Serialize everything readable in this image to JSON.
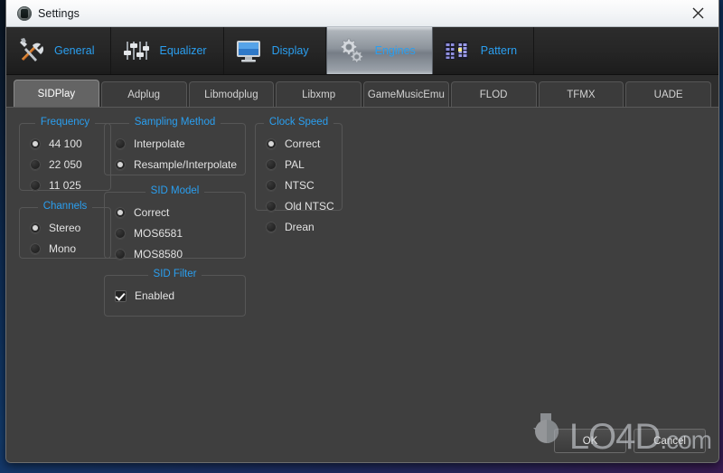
{
  "window": {
    "title": "Settings",
    "app_icon": "app-logo-icon",
    "close_icon": "close-icon",
    "accent_color": "#2a9ff0",
    "panel_color": "#3f3f3f"
  },
  "toolbar": {
    "tabs": [
      {
        "label": "General",
        "icon": "tools-icon",
        "active": false
      },
      {
        "label": "Equalizer",
        "icon": "sliders-icon",
        "active": false
      },
      {
        "label": "Display",
        "icon": "monitor-icon",
        "active": false
      },
      {
        "label": "Engines",
        "icon": "gears-icon",
        "active": true
      },
      {
        "label": "Pattern",
        "icon": "tracker-icon",
        "active": false
      }
    ]
  },
  "subtabs": {
    "items": [
      {
        "label": "SIDPlay",
        "active": true
      },
      {
        "label": "Adplug",
        "active": false
      },
      {
        "label": "Libmodplug",
        "active": false
      },
      {
        "label": "Libxmp",
        "active": false
      },
      {
        "label": "GameMusicEmu",
        "active": false
      },
      {
        "label": "FLOD",
        "active": false
      },
      {
        "label": "TFMX",
        "active": false
      },
      {
        "label": "UADE",
        "active": false
      }
    ]
  },
  "groups": {
    "frequency": {
      "title": "Frequency",
      "options": [
        {
          "label": "44 100",
          "selected": true
        },
        {
          "label": "22 050",
          "selected": false
        },
        {
          "label": "11 025",
          "selected": false
        }
      ]
    },
    "channels": {
      "title": "Channels",
      "options": [
        {
          "label": "Stereo",
          "selected": true
        },
        {
          "label": "Mono",
          "selected": false
        }
      ]
    },
    "sampling_method": {
      "title": "Sampling Method",
      "options": [
        {
          "label": "Interpolate",
          "selected": false
        },
        {
          "label": "Resample/Interpolate",
          "selected": true
        }
      ]
    },
    "sid_model": {
      "title": "SID Model",
      "options": [
        {
          "label": "Correct",
          "selected": true
        },
        {
          "label": "MOS6581",
          "selected": false
        },
        {
          "label": "MOS8580",
          "selected": false
        }
      ]
    },
    "sid_filter": {
      "title": "SID Filter",
      "options": [
        {
          "label": "Enabled",
          "checked": true
        }
      ]
    },
    "clock_speed": {
      "title": "Clock Speed",
      "options": [
        {
          "label": "Correct",
          "selected": true
        },
        {
          "label": "PAL",
          "selected": false
        },
        {
          "label": "NTSC",
          "selected": false
        },
        {
          "label": "Old NTSC",
          "selected": false
        },
        {
          "label": "Drean",
          "selected": false
        }
      ]
    }
  },
  "buttons": {
    "ok": "OK",
    "cancel": "Cancel"
  },
  "watermark": {
    "text": "LO4D",
    "suffix": ".com"
  }
}
